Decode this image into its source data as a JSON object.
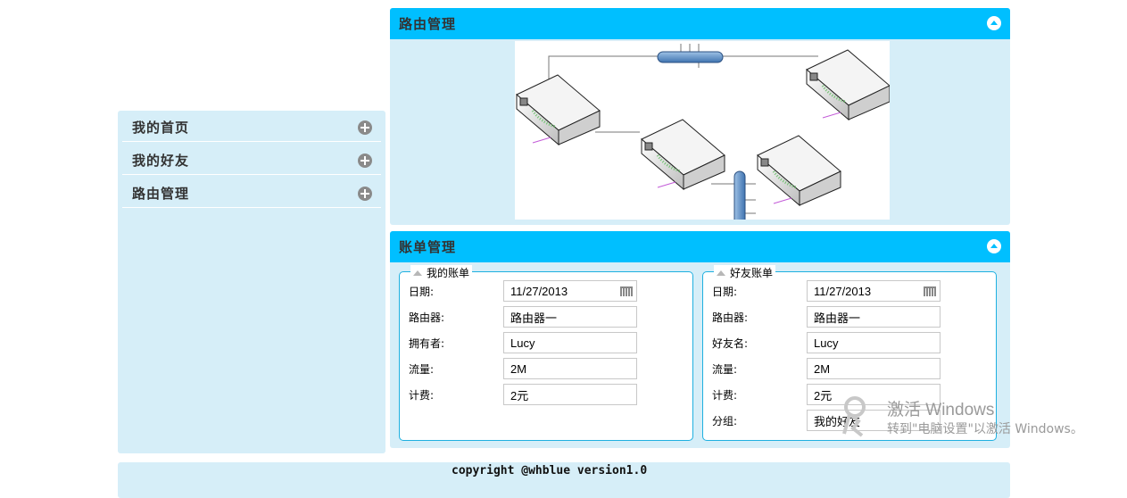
{
  "sidebar": {
    "items": [
      {
        "label": "我的首页"
      },
      {
        "label": "我的好友"
      },
      {
        "label": "路由管理"
      }
    ]
  },
  "router_panel": {
    "title": "路由管理"
  },
  "bill_panel": {
    "title": "账单管理",
    "my_bill": {
      "legend": "我的账单",
      "fields": [
        {
          "label": "日期:",
          "value": "11/27/2013"
        },
        {
          "label": "路由器:",
          "value": "路由器一"
        },
        {
          "label": "拥有者:",
          "value": "Lucy"
        },
        {
          "label": "流量:",
          "value": "2M"
        },
        {
          "label": "计费:",
          "value": "2元"
        }
      ]
    },
    "friend_bill": {
      "legend": "好友账单",
      "fields": [
        {
          "label": "日期:",
          "value": "11/27/2013"
        },
        {
          "label": "路由器:",
          "value": "路由器一"
        },
        {
          "label": "好友名:",
          "value": "Lucy"
        },
        {
          "label": "流量:",
          "value": "2M"
        },
        {
          "label": "计费:",
          "value": "2元"
        },
        {
          "label": "分组:",
          "value": "我的好友"
        }
      ]
    }
  },
  "footer": {
    "text": "copyright @whblue version1.0"
  },
  "watermark": {
    "title": "激活 Windows",
    "subtitle": "转到\"电脑设置\"以激活 Windows。"
  },
  "colors": {
    "header": "#00bfff",
    "panel_bg": "#d6eef8",
    "fieldset_border": "#1fb0e0"
  },
  "icons": {
    "nav": "plus-circle-icon",
    "collapse": "chevron-up-circle-icon",
    "calendar": "calendar-icon"
  }
}
